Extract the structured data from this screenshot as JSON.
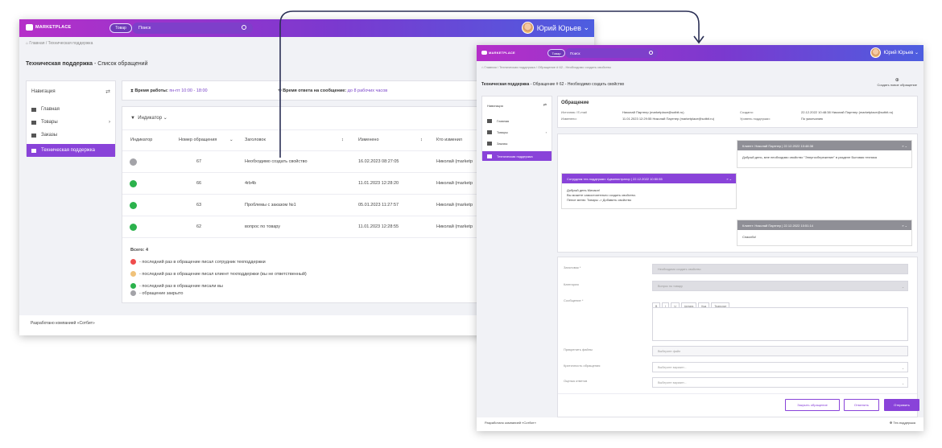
{
  "app": {
    "brand": "MARKETPLACE",
    "search_tag": "Товар",
    "search_placeholder": "Поиск",
    "user_name": "Юрий Юрьев",
    "user_caret": "⌄"
  },
  "list_page": {
    "breadcrumb": "⌂  Главная  /  Техническая поддержка",
    "title": "Техническая поддержка",
    "title_sub": " - Список обращений",
    "nav": {
      "title": "Навигация",
      "switch": "⇄",
      "items": [
        {
          "label": "Главная",
          "icon": "home-icon"
        },
        {
          "label": "Товары",
          "icon": "box-icon",
          "arrow": "›"
        },
        {
          "label": "Заказы",
          "icon": "cart-icon"
        }
      ],
      "active": "Техническая поддержка"
    },
    "work_time_label": "Время работы:",
    "work_time_value": "пн-пт 10:00 - 18:00",
    "response_label": "Время ответа на сообщение:",
    "response_value": "до 8 рабочих часов",
    "filter_label": "Индикатор",
    "columns": [
      "Индикатор",
      "Номер обращения",
      "Заголовок",
      "Изменено",
      "Кто изменил"
    ],
    "rows": [
      {
        "color": "#a3a3a8",
        "num": "67",
        "title": "Необходимо создать свойство",
        "changed": "16.02.2023 08:27:05",
        "who": "Николай (marketp"
      },
      {
        "color": "#2bb24c",
        "num": "66",
        "title": "4rb4b",
        "changed": "11.01.2023 12:28:20",
        "who": "Николай (marketp"
      },
      {
        "color": "#2bb24c",
        "num": "63",
        "title": "Проблемы с заказом №1",
        "changed": "05.01.2023 11:27:57",
        "who": "Николай (marketp"
      },
      {
        "color": "#2bb24c",
        "num": "62",
        "title": "вопрос по товару",
        "changed": "11.01.2023 12:28:55",
        "who": "Николай (marketp"
      }
    ],
    "total": "Всего: 4",
    "legend": [
      {
        "color": "#ef4d4d",
        "text": "- последний раз в обращение писал сотрудник техподдержки"
      },
      {
        "color": "#f0c27a",
        "text": "- последний раз в обращение писал клиент техподдержки (вы не ответственный)"
      },
      {
        "color": "#2bb24c",
        "text": "- последний раз в обращение писали вы"
      },
      {
        "color": "#a3a3a8",
        "text": "- обращение закрыто"
      }
    ],
    "footer": "Разработано компанией «Сотбит»"
  },
  "detail_page": {
    "breadcrumb": "⌂  Главная  /  Техническая поддержка  /  Обращение # 62 - Необходимо создать свойство",
    "title": "Техническая поддержка",
    "title_sub": " - Обращение # 62 - Необходимо создать свойство",
    "new_request": "Создать новое обращение",
    "request": {
      "heading": "Обращение",
      "source_label": "Источник / E-mail",
      "source_value": "Николай Партнер (marketplace@sotbit.ru)",
      "modified_label": "Изменено:",
      "modified_value": "11.01.2023 12:29:55 Николай Партнер (marketplace@sotbit.ru)",
      "created_label": "Создано:",
      "created_value": "22.12.2022 10:48:38 Николай Партнер (marketplace@sotbit.ru)",
      "level_label": "Уровень поддержки:",
      "level_value": "По умолчанию"
    },
    "messages": [
      {
        "header": "Клиент: Николай Партнер | 22.12.2022 10:48:38",
        "body": "Добрый день, мне необходимо свойство \"Энергосбережение\" в разделе Бытовая техника"
      },
      {
        "header": "Сотрудник тех.поддержки: Администратор | 22.12.2022 10:50:55",
        "body": "Добрый день Михаил!|Вы можете самостоятельно создать свойство.|Пепсе меню: Товары -> Добавить свойство"
      },
      {
        "header": "Клиент: Николай Партнер | 22.12.2022 10:51:14",
        "body": "Спасибо!"
      }
    ],
    "form": {
      "title_label": "Заголовок *",
      "title_value": "Необходимо создать свойство",
      "category_label": "Категория",
      "category_value": "Вопрос по товару",
      "message_label": "Сообщение *",
      "toolbar": [
        "B",
        "I",
        "U",
        "Цитата",
        "Код",
        "Транслит"
      ],
      "files_label": "Прикрепить файлы",
      "files_value": "Выберите файл",
      "criticality_label": "Критичность обращения",
      "criticality_value": "Выберите вариант...",
      "rating_label": "Оценка ответов",
      "rating_value": "Выберите вариант..."
    },
    "buttons": {
      "close": "Закрыть обращение",
      "cancel": "Отменить",
      "send": "Отправить"
    },
    "footer": "Разработано компанией «Сотбит»",
    "support_link": "Тех.поддержка"
  }
}
